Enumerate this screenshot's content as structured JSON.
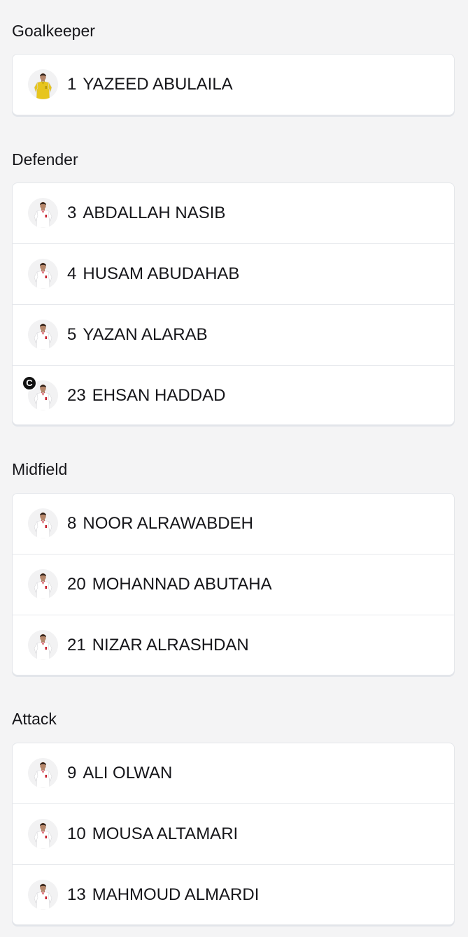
{
  "sections": [
    {
      "title": "Goalkeeper",
      "players": [
        {
          "number": "1",
          "name": "YAZEED ABULAILA",
          "kit": "goalkeeper",
          "captain": false
        }
      ]
    },
    {
      "title": "Defender",
      "players": [
        {
          "number": "3",
          "name": "ABDALLAH NASIB",
          "kit": "outfield",
          "captain": false
        },
        {
          "number": "4",
          "name": "HUSAM ABUDAHAB",
          "kit": "outfield",
          "captain": false
        },
        {
          "number": "5",
          "name": "YAZAN ALARAB",
          "kit": "outfield",
          "captain": false
        },
        {
          "number": "23",
          "name": "EHSAN HADDAD",
          "kit": "outfield",
          "captain": true,
          "captain_badge": "C"
        }
      ]
    },
    {
      "title": "Midfield",
      "players": [
        {
          "number": "8",
          "name": "NOOR ALRAWABDEH",
          "kit": "outfield",
          "captain": false
        },
        {
          "number": "20",
          "name": "MOHANNAD ABUTAHA",
          "kit": "outfield",
          "captain": false
        },
        {
          "number": "21",
          "name": "NIZAR ALRASHDAN",
          "kit": "outfield",
          "captain": false
        }
      ]
    },
    {
      "title": "Attack",
      "players": [
        {
          "number": "9",
          "name": "ALI OLWAN",
          "kit": "outfield",
          "captain": false
        },
        {
          "number": "10",
          "name": "MOUSA ALTAMARI",
          "kit": "outfield",
          "captain": false
        },
        {
          "number": "13",
          "name": "MAHMOUD ALMARDI",
          "kit": "outfield",
          "captain": false
        }
      ]
    }
  ],
  "colors": {
    "background": "#f4f4f5",
    "card": "#ffffff",
    "divider": "#e6e8ec",
    "goalkeeper_kit": "#e7c51d",
    "outfield_kit": "#ffffff",
    "kit_accent": "#c8202f",
    "captain_badge": "#111111"
  }
}
